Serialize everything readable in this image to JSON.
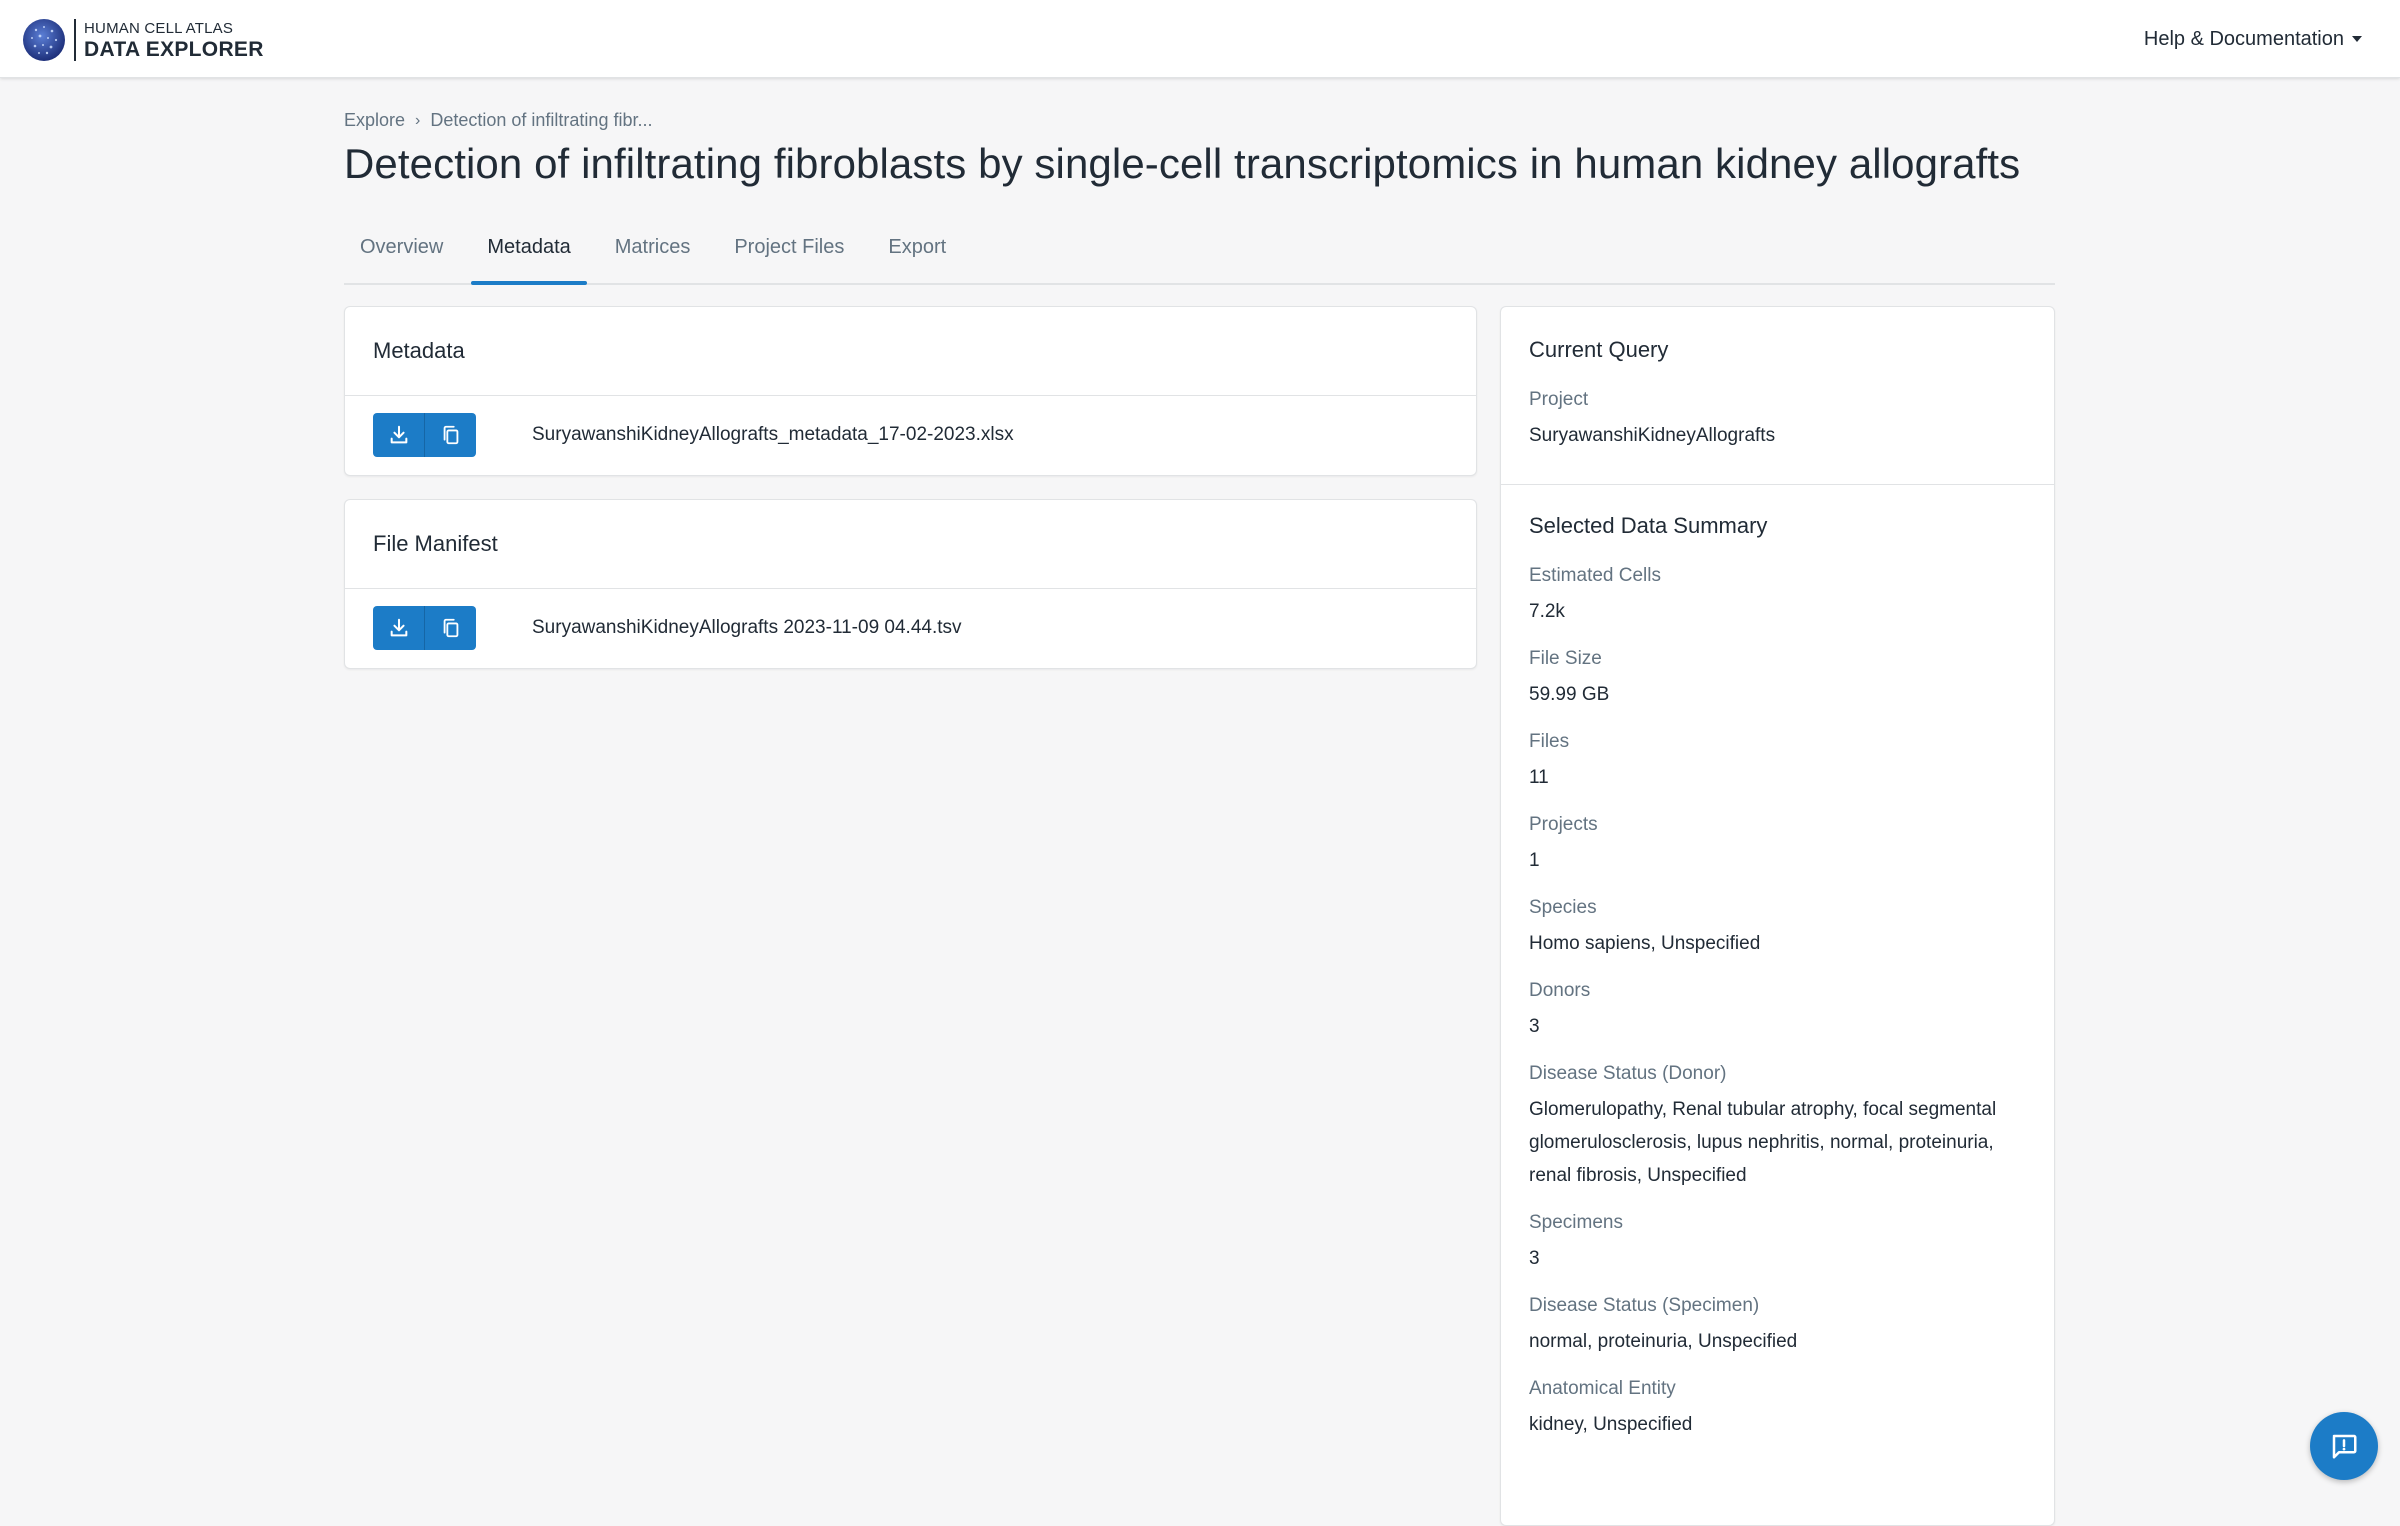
{
  "header": {
    "logo_small": "HUMAN CELL ATLAS",
    "logo_big": "DATA EXPLORER",
    "help_label": "Help & Documentation"
  },
  "breadcrumb": {
    "root": "Explore",
    "current": "Detection of infiltrating fibr..."
  },
  "page_title": "Detection of infiltrating fibroblasts by single-cell transcriptomics in human kidney allografts",
  "tabs": [
    {
      "label": "Overview",
      "active": false
    },
    {
      "label": "Metadata",
      "active": true
    },
    {
      "label": "Matrices",
      "active": false
    },
    {
      "label": "Project Files",
      "active": false
    },
    {
      "label": "Export",
      "active": false
    }
  ],
  "metadata_card": {
    "title": "Metadata",
    "file_name": "SuryawanshiKidneyAllografts_metadata_17-02-2023.xlsx"
  },
  "manifest_card": {
    "title": "File Manifest",
    "file_name": "SuryawanshiKidneyAllografts 2023-11-09 04.44.tsv"
  },
  "current_query": {
    "heading": "Current Query",
    "label": "Project",
    "value": "SuryawanshiKidneyAllografts"
  },
  "summary": {
    "heading": "Selected Data Summary",
    "fields": [
      {
        "label": "Estimated Cells",
        "value": "7.2k"
      },
      {
        "label": "File Size",
        "value": "59.99 GB"
      },
      {
        "label": "Files",
        "value": "11"
      },
      {
        "label": "Projects",
        "value": "1"
      },
      {
        "label": "Species",
        "value": "Homo sapiens, Unspecified"
      },
      {
        "label": "Donors",
        "value": "3"
      },
      {
        "label": "Disease Status (Donor)",
        "value": "Glomerulopathy, Renal tubular atrophy, focal segmental glomerulosclerosis, lupus nephritis, normal, proteinuria, renal fibrosis, Unspecified"
      },
      {
        "label": "Specimens",
        "value": "3"
      },
      {
        "label": "Disease Status (Specimen)",
        "value": "normal, proteinuria, Unspecified"
      },
      {
        "label": "Anatomical Entity",
        "value": "kidney, Unspecified"
      }
    ]
  },
  "colors": {
    "primary": "#1c7cc7",
    "background": "#f6f6f7",
    "text": "#212b36",
    "muted": "#637381"
  }
}
